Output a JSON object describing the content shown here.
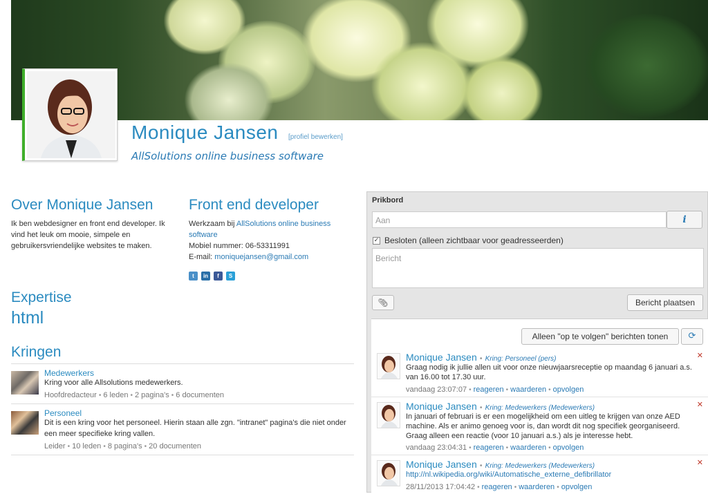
{
  "profile": {
    "name": "Monique Jansen",
    "edit_link": "[profiel bewerken]",
    "company": "AllSolutions online business software"
  },
  "about": {
    "heading": "Over Monique Jansen",
    "text": "Ik ben webdesigner en front end developer. Ik vind het leuk om mooie, simpele en gebruikersvriendelijke websites te maken."
  },
  "job": {
    "heading": "Front end developer",
    "works_prefix": "Werkzaam bij",
    "works_company": "AllSolutions online business software",
    "phone": "Mobiel nummer: 06-53311991",
    "email_prefix": "E-mail:",
    "email": "moniquejansen@gmail.com",
    "social": [
      {
        "icon": "twitter-icon",
        "label": "t",
        "color": "#4a90c8"
      },
      {
        "icon": "linkedin-icon",
        "label": "in",
        "color": "#2a6fa8"
      },
      {
        "icon": "facebook-icon",
        "label": "f",
        "color": "#3b5998"
      },
      {
        "icon": "skype-icon",
        "label": "S",
        "color": "#2aa0d8"
      }
    ]
  },
  "expertise": {
    "heading": "Expertise",
    "value": "html"
  },
  "kringen": {
    "heading": "Kringen",
    "items": [
      {
        "title": "Medewerkers",
        "description": "Kring voor alle Allsolutions medewerkers.",
        "role": "Hoofdredacteur",
        "members": "6 leden",
        "pages": "2 pagina's",
        "documents": "6 documenten"
      },
      {
        "title": "Personeel",
        "description": "Dit is een kring voor het personeel. Hierin staan alle zgn. \"intranet\" pagina's die niet onder een meer specifieke kring vallen.",
        "role": "Leider",
        "members": "10 leden",
        "pages": "8 pagina's",
        "documents": "20 documenten"
      }
    ]
  },
  "board": {
    "title": "Prikbord",
    "to_placeholder": "Aan",
    "info_label": "i",
    "closed_label": "Besloten (alleen zichtbaar voor geadresseerden)",
    "closed_checked": true,
    "message_placeholder": "Bericht",
    "post_label": "Bericht plaatsen",
    "follow_label": "Alleen \"op te volgen\" berichten tonen",
    "posts": [
      {
        "author": "Monique Jansen",
        "kring": "Kring: Personeel (pers)",
        "text": "Graag nodig ik jullie allen uit voor onze nieuwjaarsreceptie op maandag 6 januari a.s. van 16.00 tot 17.30 uur.",
        "time": "vandaag 23:07:07",
        "actions": [
          "reageren",
          "waarderen",
          "opvolgen"
        ]
      },
      {
        "author": "Monique Jansen",
        "kring": "Kring: Medewerkers (Medewerkers)",
        "text": "In januari of februari is er een mogelijkheid om een uitleg te krijgen van onze AED machine. Als er animo genoeg voor is, dan wordt dit nog specifiek georganiseerd. Graag alleen een reactie (voor 10 januari a.s.) als je interesse hebt.",
        "time": "vandaag 23:04:31",
        "actions": [
          "reageren",
          "waarderen",
          "opvolgen"
        ]
      },
      {
        "author": "Monique Jansen",
        "kring": "Kring: Medewerkers (Medewerkers)",
        "text": "http://nl.wikipedia.org/wiki/Automatische_externe_defibrillator",
        "time": "28/11/2013 17:04:42",
        "actions": [
          "reageren",
          "waarderen",
          "opvolgen"
        ]
      }
    ]
  }
}
